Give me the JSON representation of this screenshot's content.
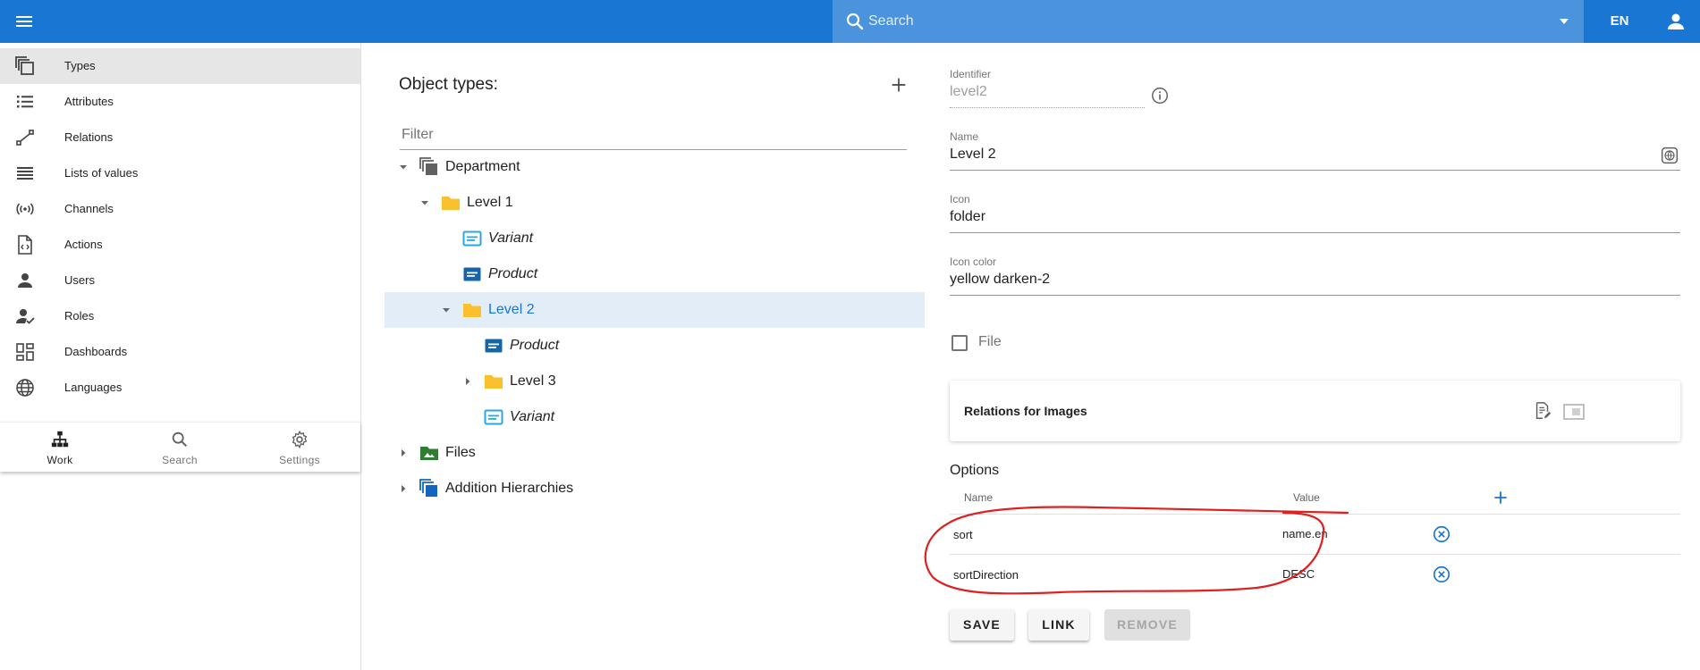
{
  "topbar": {
    "search_placeholder": "Search",
    "language": "EN",
    "colors": {
      "bar": "#1976d2",
      "search": "#4b93dc"
    }
  },
  "sidebar": {
    "items": [
      {
        "label": "Types",
        "icon": "types-icon",
        "active": true
      },
      {
        "label": "Attributes",
        "icon": "list-bullets-icon"
      },
      {
        "label": "Relations",
        "icon": "relation-line-icon"
      },
      {
        "label": "Lists of values",
        "icon": "lines-icon"
      },
      {
        "label": "Channels",
        "icon": "broadcast-icon"
      },
      {
        "label": "Actions",
        "icon": "code-file-icon"
      },
      {
        "label": "Users",
        "icon": "person-icon"
      },
      {
        "label": "Roles",
        "icon": "person-check-icon"
      },
      {
        "label": "Dashboards",
        "icon": "dashboard-icon"
      },
      {
        "label": "Languages",
        "icon": "globe-icon"
      }
    ],
    "bottom_nav": [
      {
        "label": "Work",
        "icon": "sitemap-icon",
        "active": true
      },
      {
        "label": "Search",
        "icon": "search-icon"
      },
      {
        "label": "Settings",
        "icon": "gear-icon"
      }
    ]
  },
  "tree": {
    "title": "Object types:",
    "filter_placeholder": "Filter",
    "nodes": [
      {
        "label": "Department"
      },
      {
        "label": "Level 1"
      },
      {
        "label": "Variant"
      },
      {
        "label": "Product"
      },
      {
        "label": "Level 2",
        "selected": true
      },
      {
        "label": "Product"
      },
      {
        "label": "Level 3"
      },
      {
        "label": "Variant"
      },
      {
        "label": "Files"
      },
      {
        "label": "Addition Hierarchies"
      }
    ]
  },
  "form": {
    "identifier": {
      "label": "Identifier",
      "value": "level2"
    },
    "name": {
      "label": "Name",
      "value": "Level 2"
    },
    "icon": {
      "label": "Icon",
      "value": "folder"
    },
    "icon_color": {
      "label": "Icon color",
      "value": "yellow darken-2"
    },
    "file_checkbox": {
      "label": "File",
      "checked": false
    },
    "relations_card": {
      "title": "Relations for Images"
    },
    "options": {
      "title": "Options",
      "col_name": "Name",
      "col_value": "Value",
      "rows": [
        {
          "name": "sort",
          "value": "name.en"
        },
        {
          "name": "sortDirection",
          "value": "DESC"
        }
      ]
    },
    "buttons": {
      "save": "SAVE",
      "link": "LINK",
      "remove": "REMOVE"
    }
  },
  "colors": {
    "accent": "#1976d2",
    "folder": "#fbc02d",
    "annotation": "#e02020",
    "files": "#2e7d32"
  }
}
